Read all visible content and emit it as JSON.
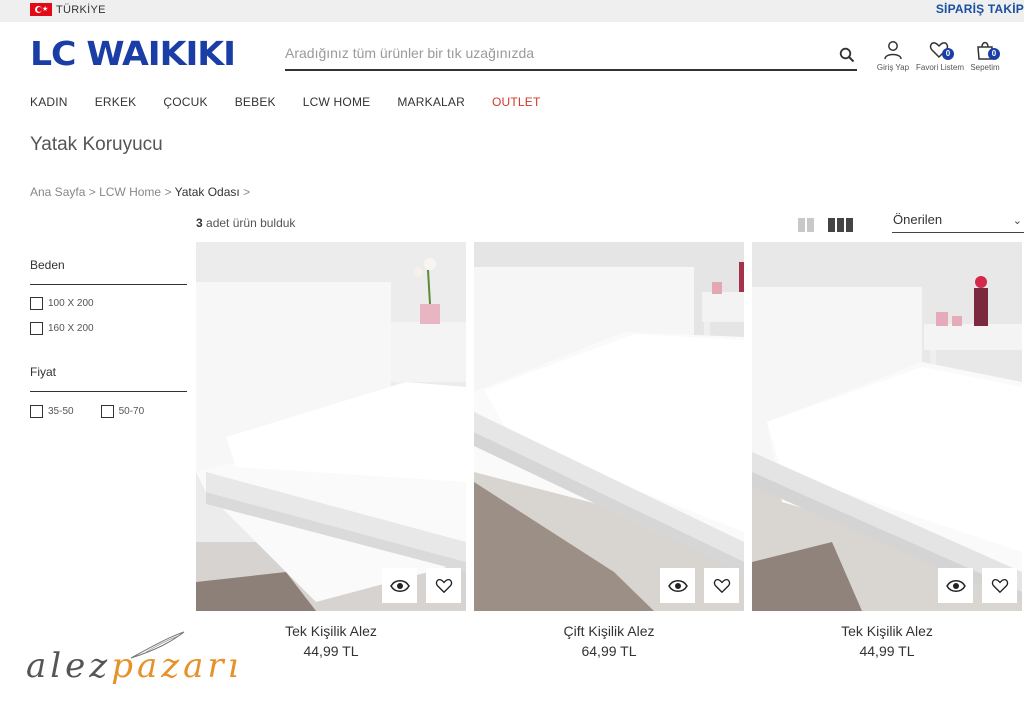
{
  "topbar": {
    "country": "TÜRKİYE",
    "order_tracking": "SİPARİŞ TAKİP"
  },
  "brand": {
    "logo_text": "LC WAIKIKI",
    "color": "#1a3ea6"
  },
  "search": {
    "placeholder": "Aradığınız tüm ürünler bir tık uzağınızda",
    "icon": "search-icon"
  },
  "header_icons": [
    {
      "label": "Giriş Yap",
      "icon": "user-icon"
    },
    {
      "label": "Favori Listem",
      "icon": "heart-icon",
      "badge": "0"
    },
    {
      "label": "Sepetim",
      "icon": "bag-icon",
      "badge": "0"
    }
  ],
  "nav": [
    "KADIN",
    "ERKEK",
    "ÇOCUK",
    "BEBEK",
    "LCW HOME",
    "MARKALAR",
    "OUTLET"
  ],
  "page": {
    "title": "Yatak Koruyucu"
  },
  "breadcrumb": {
    "items": [
      "Ana Sayfa",
      "LCW Home",
      "Yatak Odası"
    ],
    "separator": ">"
  },
  "results": {
    "count": "3",
    "text": "adet ürün bulduk"
  },
  "sort": {
    "selected": "Önerilen"
  },
  "filters": {
    "size": {
      "title": "Beden",
      "options": [
        "100 X 200",
        "160 X 200"
      ]
    },
    "price": {
      "title": "Fiyat",
      "options": [
        "35-50",
        "50-70"
      ]
    }
  },
  "products": [
    {
      "name": "Tek Kişilik Alez",
      "price": "44,99 TL"
    },
    {
      "name": "Çift Kişilik Alez",
      "price": "64,99 TL"
    },
    {
      "name": "Tek Kişilik Alez",
      "price": "44,99 TL"
    }
  ],
  "watermark": {
    "text_a": "alez",
    "text_b": "pazarı"
  },
  "colors": {
    "accent": "#1a3ea6",
    "outlet": "#d0382a",
    "watermark_orange": "#e5922b"
  }
}
